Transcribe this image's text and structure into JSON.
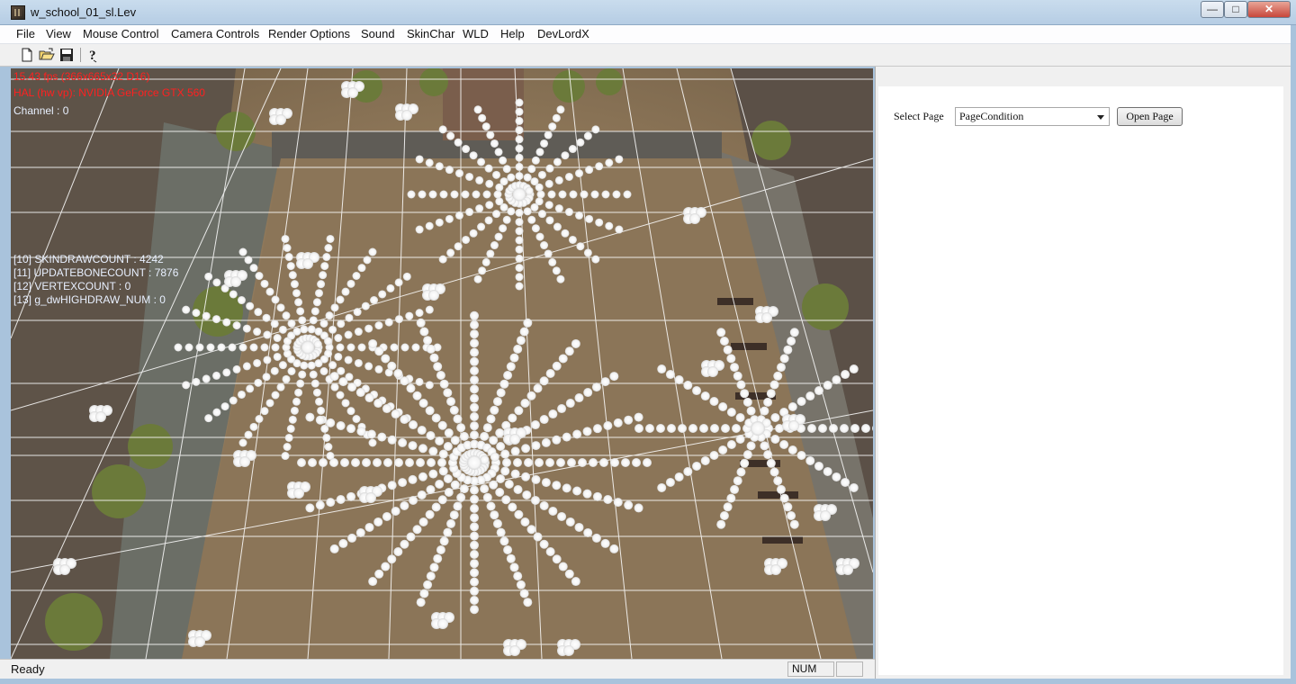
{
  "window": {
    "title": "w_school_01_sl.Lev",
    "minimize_label": "—",
    "maximize_label": "□",
    "close_label": "✕"
  },
  "menu": [
    "File",
    "View",
    "Mouse Control",
    "Camera Controls",
    "Render Options",
    "Sound",
    "SkinChar",
    "WLD",
    "Help",
    "DevLordX"
  ],
  "toolbar": {
    "buttons": [
      "new-file-icon",
      "open-folder-icon",
      "save-icon",
      "help-icon"
    ]
  },
  "viewport": {
    "hud_red_lines": [
      "15.43 fps (366x665x32 D16)",
      "HAL (hw vp): NVIDIA GeForce GTX 560"
    ],
    "channel_text": "Channel : 0",
    "debug_lines": [
      "[10] SKINDRAWCOUNT : 4242",
      "[11] UPDATEBONECOUNT : 7876",
      "[12] VERTEXCOUNT : 0",
      "[13] g_dwHIGHDRAW_NUM : 0"
    ]
  },
  "status": {
    "text": "Ready",
    "num_indicator": "NUM"
  },
  "panel": {
    "select_label": "Select Page",
    "select_value": "PageCondition",
    "open_button": "Open Page"
  },
  "colors": {
    "hud_red": "#ff2020",
    "ground": "#8d7658",
    "particle": "#ffffff"
  }
}
